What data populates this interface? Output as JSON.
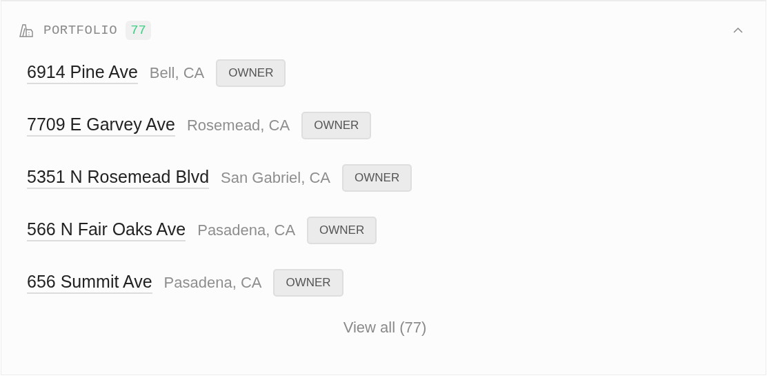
{
  "section": {
    "title": "PORTFOLIO",
    "count": "77",
    "expanded": true
  },
  "properties": [
    {
      "address": "6914 Pine Ave",
      "city": "Bell, CA",
      "role": "OWNER"
    },
    {
      "address": "7709 E Garvey Ave",
      "city": "Rosemead, CA",
      "role": "OWNER"
    },
    {
      "address": "5351 N Rosemead Blvd",
      "city": "San Gabriel, CA",
      "role": "OWNER"
    },
    {
      "address": "566 N Fair Oaks Ave",
      "city": "Pasadena, CA",
      "role": "OWNER"
    },
    {
      "address": "656 Summit Ave",
      "city": "Pasadena, CA",
      "role": "OWNER"
    }
  ],
  "view_all": "View all (77)"
}
